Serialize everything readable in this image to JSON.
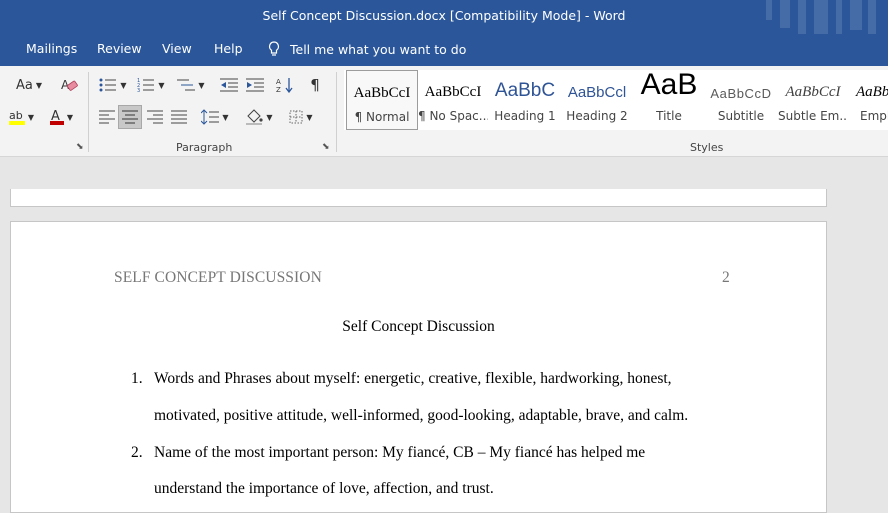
{
  "window": {
    "title": "Self Concept Discussion.docx [Compatibility Mode]  -  Word"
  },
  "menu": {
    "items": [
      "Mailings",
      "Review",
      "View",
      "Help"
    ],
    "tell_me": "Tell me what you want to do"
  },
  "ribbon": {
    "font_size_btn": "Aa",
    "paragraph_label": "Paragraph",
    "styles_label": "Styles",
    "pilcrow": "¶",
    "styles": [
      {
        "sample": "AaBbCcI",
        "name": "¶ Normal"
      },
      {
        "sample": "AaBbCcI",
        "name": "¶ No Spac..."
      },
      {
        "sample": "AaBbC",
        "name": "Heading 1"
      },
      {
        "sample": "AaBbCcl",
        "name": "Heading 2"
      },
      {
        "sample": "AaB",
        "name": "Title"
      },
      {
        "sample": "AaBbCcD",
        "name": "Subtitle"
      },
      {
        "sample": "AaBbCcI",
        "name": "Subtle Em..."
      },
      {
        "sample": "AaBb",
        "name": "Emph"
      }
    ]
  },
  "document": {
    "running_head": "SELF CONCEPT DISCUSSION",
    "page_number": "2",
    "title": "Self Concept Discussion",
    "items": [
      {
        "number": "1.",
        "lines": [
          "Words and Phrases about myself: energetic, creative, flexible, hardworking, honest,",
          "motivated, positive attitude, well-informed, good-looking, adaptable, brave, and calm."
        ]
      },
      {
        "number": "2.",
        "lines": [
          "Name of the most important person: My fiancé, CB – My fiancé has helped me",
          "understand the importance of love, affection, and trust."
        ]
      }
    ]
  },
  "colors": {
    "title_bar": "#2b579a",
    "font_color_red": "#c00000",
    "highlight_yellow": "#ffff00",
    "heading_blue": "#2f5496"
  }
}
